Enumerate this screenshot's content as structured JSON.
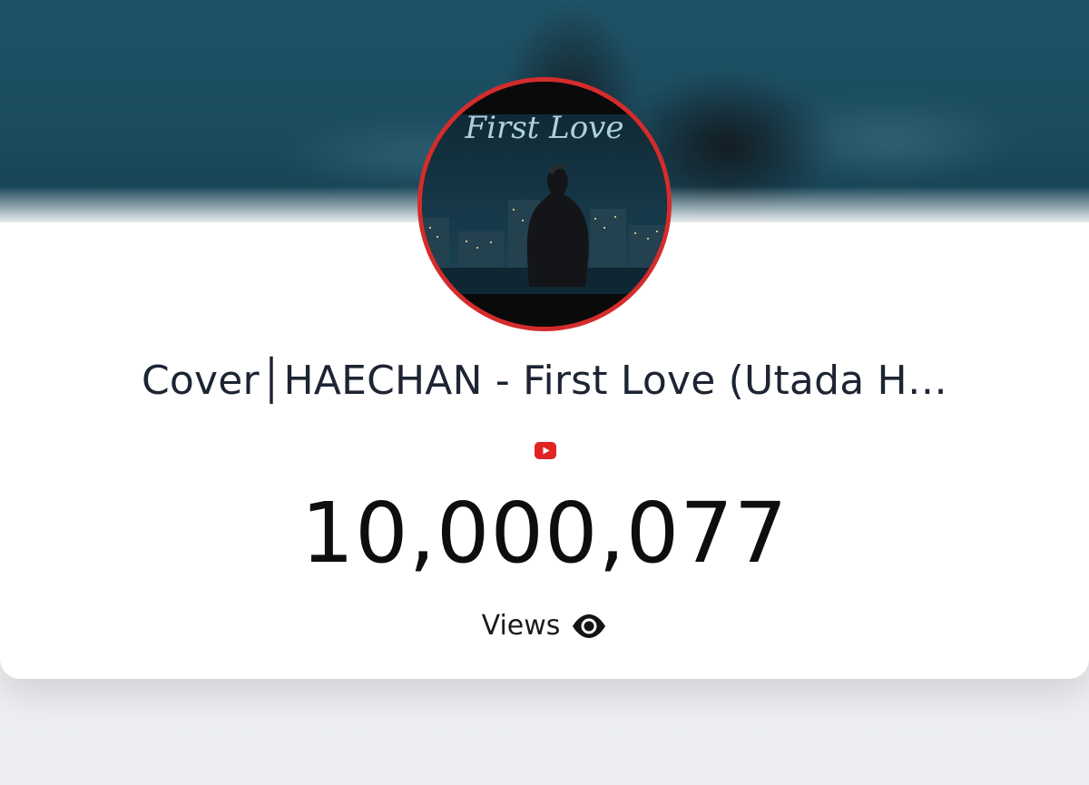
{
  "video": {
    "title": "Cover│HAECHAN - First Love (Utada H…",
    "thumbnail_text": "First Love",
    "platform_icon": "youtube-icon",
    "view_count": "10,000,077",
    "views_label": "Views",
    "views_icon": "eye-icon"
  },
  "colors": {
    "ring": "#d42c2c",
    "youtube_red": "#e02424",
    "text": "#1d2433"
  }
}
